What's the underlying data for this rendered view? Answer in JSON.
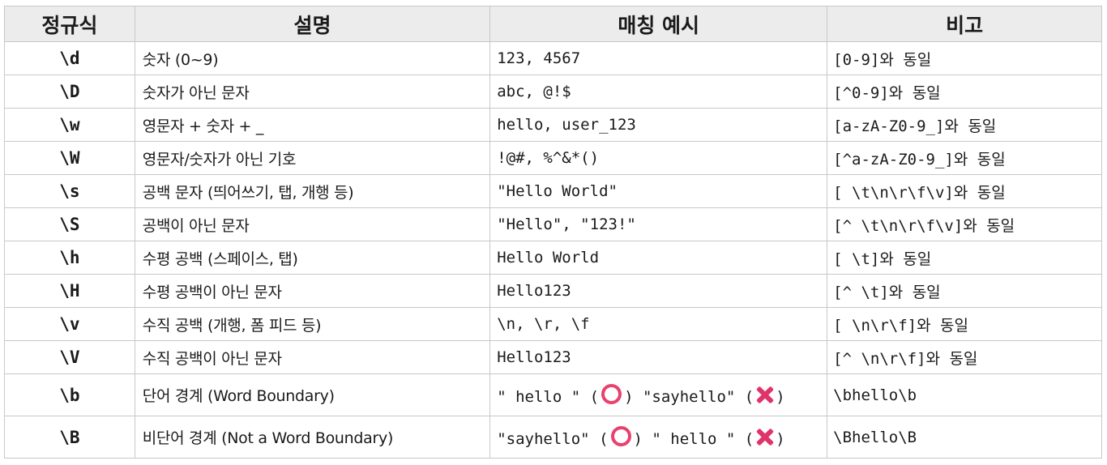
{
  "headers": [
    "정규식",
    "설명",
    "매칭 예시",
    "비고"
  ],
  "rows": [
    {
      "regex": "\\d",
      "desc": "숫자 (0~9)",
      "example": "123, 4567",
      "note": "[0-9]와 동일"
    },
    {
      "regex": "\\D",
      "desc": "숫자가 아닌 문자",
      "example": "abc, @!$",
      "note": "[^0-9]와 동일"
    },
    {
      "regex": "\\w",
      "desc": "영문자 + 숫자 + _",
      "example": "hello, user_123",
      "note": "[a-zA-Z0-9_]와 동일"
    },
    {
      "regex": "\\W",
      "desc": "영문자/숫자가 아닌 기호",
      "example": "!@#, %^&*()",
      "note": "[^a-zA-Z0-9_]와 동일"
    },
    {
      "regex": "\\s",
      "desc": "공백 문자 (띄어쓰기, 탭, 개행 등)",
      "example": "\"Hello World\"",
      "note": "[ \\t\\n\\r\\f\\v]와 동일"
    },
    {
      "regex": "\\S",
      "desc": "공백이 아닌 문자",
      "example": "\"Hello\", \"123!\"",
      "note": "[^ \\t\\n\\r\\f\\v]와 동일"
    },
    {
      "regex": "\\h",
      "desc": "수평 공백 (스페이스, 탭)",
      "example": "Hello World",
      "note": "[ \\t]와 동일"
    },
    {
      "regex": "\\H",
      "desc": "수평 공백이 아닌 문자",
      "example": "Hello123",
      "note": "[^ \\t]와 동일"
    },
    {
      "regex": "\\v",
      "desc": "수직 공백 (개행, 폼 피드 등)",
      "example": "\\n, \\r, \\f",
      "note": "[ \\n\\r\\f]와 동일"
    },
    {
      "regex": "\\V",
      "desc": "수직 공백이 아닌 문자",
      "example": "Hello123",
      "note": "[^ \\n\\r\\f]와 동일"
    },
    {
      "regex": "\\b",
      "desc": "단어 경계 (Word Boundary)",
      "example_a": "\" hello \" (",
      "example_b": ") \"sayhello\" (",
      "example_c": ")",
      "note": "\\bhello\\b"
    },
    {
      "regex": "\\B",
      "desc": "비단어 경계 (Not a Word Boundary)",
      "example_a": "\"sayhello\" (",
      "example_b": ") \" hello \" (",
      "example_c": ")",
      "note": "\\Bhello\\B"
    }
  ],
  "icons": {
    "match": "circle-o-icon",
    "nomatch": "cross-x-icon"
  },
  "colors": {
    "header_bg": "#ececec",
    "mark": "#e8416e"
  }
}
